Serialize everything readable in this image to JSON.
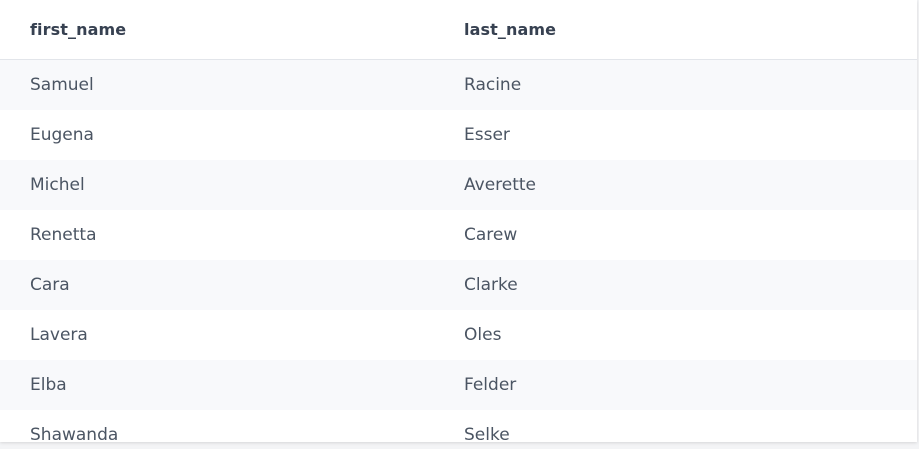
{
  "table": {
    "columns": [
      "first_name",
      "last_name"
    ],
    "rows": [
      [
        "Samuel",
        "Racine"
      ],
      [
        "Eugena",
        "Esser"
      ],
      [
        "Michel",
        "Averette"
      ],
      [
        "Renetta",
        "Carew"
      ],
      [
        "Cara",
        "Clarke"
      ],
      [
        "Lavera",
        "Oles"
      ],
      [
        "Elba",
        "Felder"
      ],
      [
        "Shawanda",
        "Selke"
      ]
    ]
  },
  "colors": {
    "header_border": "#e2e5ea",
    "striped_row": "#f8f9fb",
    "text": "#4b5563",
    "header_text": "#374151"
  }
}
